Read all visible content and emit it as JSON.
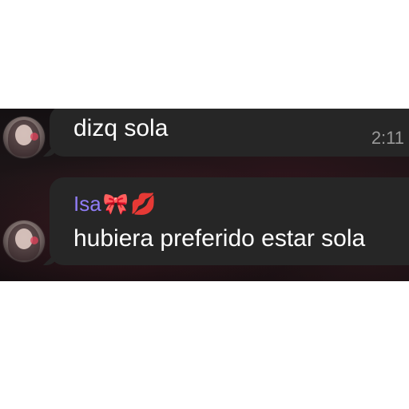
{
  "messages": [
    {
      "text": "dizq sola",
      "time": "2:11"
    },
    {
      "sender": "Isa",
      "sender_emojis": [
        "🎀",
        "💋"
      ],
      "text": "hubiera preferido estar sola"
    }
  ],
  "colors": {
    "bubble": "#262626",
    "sender_name": "#8f7cf5",
    "timestamp": "#9a9a9a",
    "background": "#141012"
  },
  "icons": {
    "bow": "ribbon-bow-emoji",
    "lips": "kiss-mark-emoji"
  }
}
